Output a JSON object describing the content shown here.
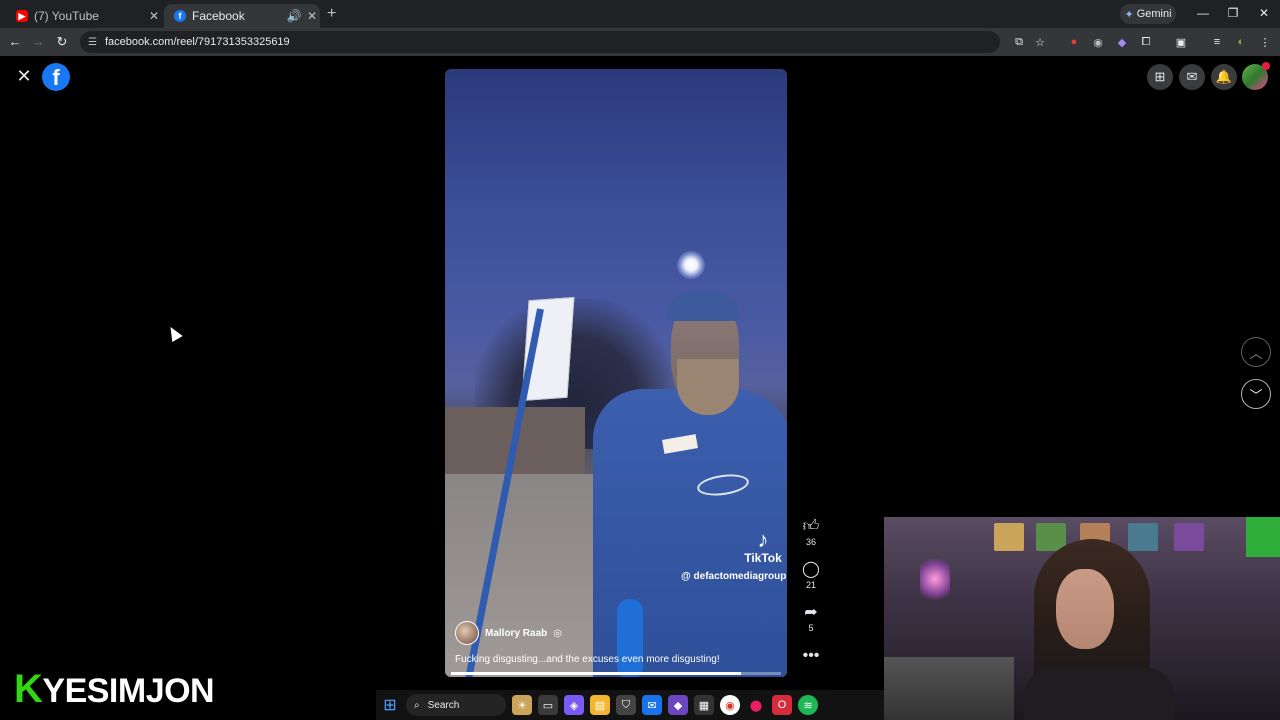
{
  "browser": {
    "tabs": [
      {
        "title": "(7) YouTube",
        "favicon": "youtube-icon",
        "active": false
      },
      {
        "title": "Facebook",
        "favicon": "facebook-icon",
        "active": true
      }
    ],
    "gemini_label": "Gemini",
    "url": "facebook.com/reel/791731353325619"
  },
  "reel": {
    "creator_name": "Mallory Raab",
    "caption": "Fucking disgusting...and the excuses even more disgusting!",
    "watermark_brand": "TikTok",
    "watermark_handle": "@ defactomediagroup",
    "progress": 0.88,
    "actions": {
      "likes": "36",
      "comments": "21",
      "shares": "5"
    }
  },
  "stream_overlay": {
    "name_k": "K",
    "name_rest": "YESIMJON"
  },
  "taskbar": {
    "search_placeholder": "Search"
  },
  "colors": {
    "facebook_blue": "#1877f2",
    "overlay_green": "#33d60f"
  }
}
